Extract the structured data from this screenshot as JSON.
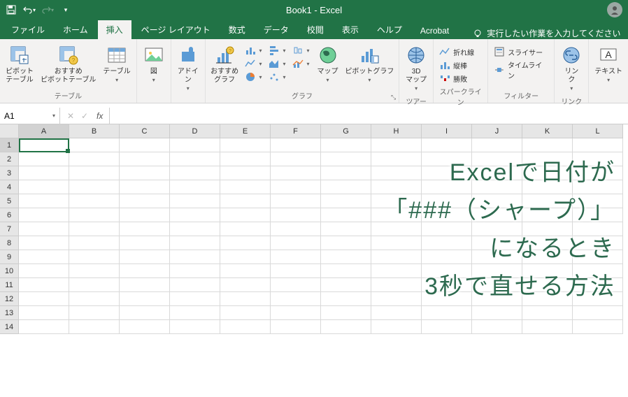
{
  "titlebar": {
    "title": "Book1  -  Excel"
  },
  "tabs": [
    "ファイル",
    "ホーム",
    "挿入",
    "ページ レイアウト",
    "数式",
    "データ",
    "校閲",
    "表示",
    "ヘルプ",
    "Acrobat"
  ],
  "active_tab": 2,
  "tellme": "実行したい作業を入力してください",
  "ribbon": {
    "tables": {
      "label": "テーブル",
      "pivot": "ピボット\nテーブル",
      "recommended": "おすすめ\nピボットテーブル",
      "table": "テーブル"
    },
    "illustrations": {
      "label": "",
      "illust": "図"
    },
    "addins": {
      "label": "",
      "addin": "アドイ\nン"
    },
    "charts": {
      "label": "グラフ",
      "recommended": "おすすめ\nグラフ",
      "map": "マップ",
      "pivotchart": "ピボットグラフ"
    },
    "tour": {
      "label": "ツアー",
      "map3d": "3D\nマップ"
    },
    "sparklines": {
      "label": "スパークライン",
      "line": "折れ線",
      "column": "縦棒",
      "winloss": "勝敗"
    },
    "filters": {
      "label": "フィルター",
      "slicer": "スライサー",
      "timeline": "タイムライン"
    },
    "links": {
      "label": "リンク",
      "link": "リン\nク"
    },
    "text": {
      "label": "",
      "text": "テキスト"
    }
  },
  "fbar": {
    "name": "A1",
    "fx": "fx"
  },
  "columns": [
    "A",
    "B",
    "C",
    "D",
    "E",
    "F",
    "G",
    "H",
    "I",
    "J",
    "K",
    "L"
  ],
  "rows": [
    "1",
    "2",
    "3",
    "4",
    "5",
    "6",
    "7",
    "8",
    "9",
    "10",
    "11",
    "12",
    "13",
    "14"
  ],
  "overlay": {
    "l1": "Excelで日付が",
    "l2": "「###（シャープ）」",
    "l3": "になるとき",
    "l4": "3秒で直せる方法"
  }
}
